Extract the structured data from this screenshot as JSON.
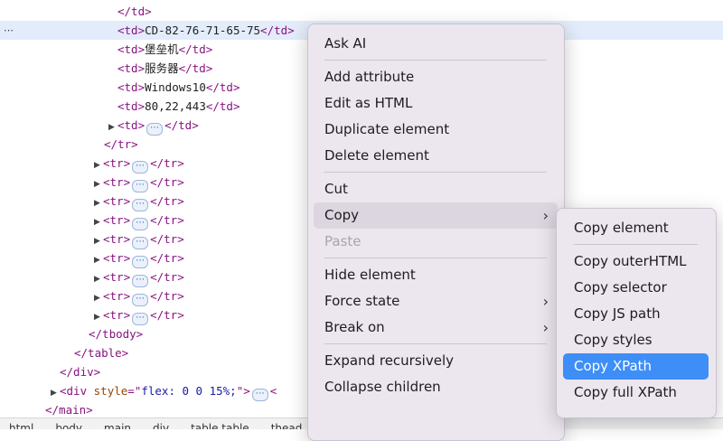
{
  "tree": {
    "ellipsis": "⋯",
    "inline_ellipsis": "⋯",
    "rows": [
      {
        "indent": 130,
        "twisty": "",
        "parts": [
          {
            "c": "tag",
            "t": "</td>"
          }
        ]
      },
      {
        "indent": 130,
        "twisty": "",
        "selected": true,
        "parts": [
          {
            "c": "tag",
            "t": "<td>"
          },
          {
            "c": "txt",
            "t": "CD-82-76-71-65-75"
          },
          {
            "c": "tag",
            "t": "</td>"
          }
        ]
      },
      {
        "indent": 130,
        "twisty": "",
        "parts": [
          {
            "c": "tag",
            "t": "<td>"
          },
          {
            "c": "txt",
            "t": "堡垒机"
          },
          {
            "c": "tag",
            "t": "</td>"
          }
        ]
      },
      {
        "indent": 130,
        "twisty": "",
        "parts": [
          {
            "c": "tag",
            "t": "<td>"
          },
          {
            "c": "txt",
            "t": "服务器"
          },
          {
            "c": "tag",
            "t": "</td>"
          }
        ]
      },
      {
        "indent": 130,
        "twisty": "",
        "parts": [
          {
            "c": "tag",
            "t": "<td>"
          },
          {
            "c": "txt",
            "t": "Windows10"
          },
          {
            "c": "tag",
            "t": "</td>"
          }
        ]
      },
      {
        "indent": 130,
        "twisty": "",
        "parts": [
          {
            "c": "tag",
            "t": "<td>"
          },
          {
            "c": "txt",
            "t": "80,22,443"
          },
          {
            "c": "tag",
            "t": "</td>"
          }
        ]
      },
      {
        "indent": 120,
        "twisty": "▶",
        "parts": [
          {
            "c": "tag",
            "t": "<td>"
          },
          {
            "c": "ell",
            "t": "⋯"
          },
          {
            "c": "tag",
            "t": "</td>"
          }
        ]
      },
      {
        "indent": 115,
        "twisty": "",
        "parts": [
          {
            "c": "tag",
            "t": "</tr>"
          }
        ]
      },
      {
        "indent": 104,
        "twisty": "▶",
        "parts": [
          {
            "c": "tag",
            "t": "<tr>"
          },
          {
            "c": "ell",
            "t": "⋯"
          },
          {
            "c": "tag",
            "t": "</tr>"
          }
        ]
      },
      {
        "indent": 104,
        "twisty": "▶",
        "parts": [
          {
            "c": "tag",
            "t": "<tr>"
          },
          {
            "c": "ell",
            "t": "⋯"
          },
          {
            "c": "tag",
            "t": "</tr>"
          }
        ]
      },
      {
        "indent": 104,
        "twisty": "▶",
        "parts": [
          {
            "c": "tag",
            "t": "<tr>"
          },
          {
            "c": "ell",
            "t": "⋯"
          },
          {
            "c": "tag",
            "t": "</tr>"
          }
        ]
      },
      {
        "indent": 104,
        "twisty": "▶",
        "parts": [
          {
            "c": "tag",
            "t": "<tr>"
          },
          {
            "c": "ell",
            "t": "⋯"
          },
          {
            "c": "tag",
            "t": "</tr>"
          }
        ]
      },
      {
        "indent": 104,
        "twisty": "▶",
        "parts": [
          {
            "c": "tag",
            "t": "<tr>"
          },
          {
            "c": "ell",
            "t": "⋯"
          },
          {
            "c": "tag",
            "t": "</tr>"
          }
        ]
      },
      {
        "indent": 104,
        "twisty": "▶",
        "parts": [
          {
            "c": "tag",
            "t": "<tr>"
          },
          {
            "c": "ell",
            "t": "⋯"
          },
          {
            "c": "tag",
            "t": "</tr>"
          }
        ]
      },
      {
        "indent": 104,
        "twisty": "▶",
        "parts": [
          {
            "c": "tag",
            "t": "<tr>"
          },
          {
            "c": "ell",
            "t": "⋯"
          },
          {
            "c": "tag",
            "t": "</tr>"
          }
        ]
      },
      {
        "indent": 104,
        "twisty": "▶",
        "parts": [
          {
            "c": "tag",
            "t": "<tr>"
          },
          {
            "c": "ell",
            "t": "⋯"
          },
          {
            "c": "tag",
            "t": "</tr>"
          }
        ]
      },
      {
        "indent": 104,
        "twisty": "▶",
        "parts": [
          {
            "c": "tag",
            "t": "<tr>"
          },
          {
            "c": "ell",
            "t": "⋯"
          },
          {
            "c": "tag",
            "t": "</tr>"
          }
        ]
      },
      {
        "indent": 98,
        "twisty": "",
        "parts": [
          {
            "c": "tag",
            "t": "</tbody>"
          }
        ]
      },
      {
        "indent": 82,
        "twisty": "",
        "parts": [
          {
            "c": "tag",
            "t": "</table>"
          }
        ]
      },
      {
        "indent": 66,
        "twisty": "",
        "parts": [
          {
            "c": "tag",
            "t": "</div>"
          }
        ]
      },
      {
        "indent": 56,
        "twisty": "▶",
        "parts": [
          {
            "c": "tag",
            "t": "<div "
          },
          {
            "c": "attr",
            "t": "style"
          },
          {
            "c": "tag",
            "t": "=\""
          },
          {
            "c": "val",
            "t": "flex: 0 0 15%;"
          },
          {
            "c": "tag",
            "t": "\">"
          },
          {
            "c": "ell",
            "t": "⋯"
          },
          {
            "c": "tag",
            "t": "<"
          }
        ]
      },
      {
        "indent": 50,
        "twisty": "",
        "parts": [
          {
            "c": "tag",
            "t": "</main>"
          }
        ]
      }
    ]
  },
  "breadcrumbs": [
    "html",
    "body",
    "main",
    "div",
    "table.table",
    "thead"
  ],
  "context_menu": {
    "items": [
      {
        "label": "Ask AI",
        "name": "menu-ask-ai"
      },
      {
        "sep": true
      },
      {
        "label": "Add attribute",
        "name": "menu-add-attribute"
      },
      {
        "label": "Edit as HTML",
        "name": "menu-edit-as-html"
      },
      {
        "label": "Duplicate element",
        "name": "menu-duplicate-element"
      },
      {
        "label": "Delete element",
        "name": "menu-delete-element"
      },
      {
        "sep": true
      },
      {
        "label": "Cut",
        "name": "menu-cut"
      },
      {
        "label": "Copy",
        "name": "menu-copy",
        "submenu": true,
        "state": "hover"
      },
      {
        "label": "Paste",
        "name": "menu-paste",
        "state": "disabled"
      },
      {
        "sep": true
      },
      {
        "label": "Hide element",
        "name": "menu-hide-element"
      },
      {
        "label": "Force state",
        "name": "menu-force-state",
        "submenu": true
      },
      {
        "label": "Break on",
        "name": "menu-break-on",
        "submenu": true
      },
      {
        "sep": true
      },
      {
        "label": "Expand recursively",
        "name": "menu-expand-recursively"
      },
      {
        "label": "Collapse children",
        "name": "menu-collapse-children"
      }
    ]
  },
  "copy_submenu": {
    "items": [
      {
        "label": "Copy element",
        "name": "submenu-copy-element"
      },
      {
        "sep": true
      },
      {
        "label": "Copy outerHTML",
        "name": "submenu-copy-outerhtml"
      },
      {
        "label": "Copy selector",
        "name": "submenu-copy-selector"
      },
      {
        "label": "Copy JS path",
        "name": "submenu-copy-js-path"
      },
      {
        "label": "Copy styles",
        "name": "submenu-copy-styles"
      },
      {
        "label": "Copy XPath",
        "name": "submenu-copy-xpath",
        "state": "active"
      },
      {
        "label": "Copy full XPath",
        "name": "submenu-copy-full-xpath"
      }
    ]
  },
  "icons": {
    "submenu_arrow": "chevron-right-icon",
    "expand": "triangle-right-icon",
    "more": "ellipsis-icon"
  },
  "colors": {
    "selection": "#e3ecfb",
    "accent": "#3e8ef7",
    "tag": "#881280",
    "attr": "#994500",
    "value": "#1a1aa6"
  }
}
